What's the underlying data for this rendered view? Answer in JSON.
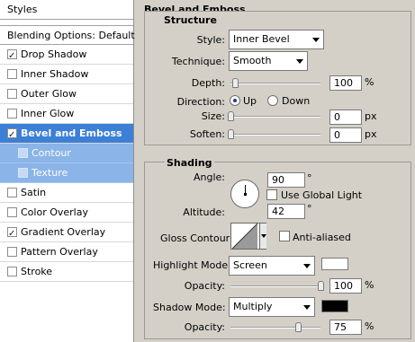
{
  "styles_panel": {
    "title": "Styles",
    "blending_options": "Blending Options: Default",
    "items": [
      {
        "label": "Drop Shadow",
        "checked": true
      },
      {
        "label": "Inner Shadow",
        "checked": false
      },
      {
        "label": "Outer Glow",
        "checked": false
      },
      {
        "label": "Inner Glow",
        "checked": false
      },
      {
        "label": "Bevel and Emboss",
        "checked": true,
        "selected": true
      },
      {
        "label": "Contour",
        "checked": false,
        "sub": true
      },
      {
        "label": "Texture",
        "checked": false,
        "sub": true
      },
      {
        "label": "Satin",
        "checked": false
      },
      {
        "label": "Color Overlay",
        "checked": false
      },
      {
        "label": "Gradient Overlay",
        "checked": true
      },
      {
        "label": "Pattern Overlay",
        "checked": false
      },
      {
        "label": "Stroke",
        "checked": false
      }
    ]
  },
  "bevel": {
    "section_title": "Bevel and Emboss",
    "structure": {
      "title": "Structure",
      "style_label": "Style:",
      "style_value": "Inner Bevel",
      "technique_label": "Technique:",
      "technique_value": "Smooth",
      "depth_label": "Depth:",
      "depth_value": "100",
      "depth_unit": "%",
      "direction_label": "Direction:",
      "direction_up": "Up",
      "direction_down": "Down",
      "direction_selected": "Up",
      "size_label": "Size:",
      "size_value": "0",
      "size_unit": "px",
      "soften_label": "Soften:",
      "soften_value": "0",
      "soften_unit": "px"
    },
    "shading": {
      "title": "Shading",
      "angle_label": "Angle:",
      "angle_value": "90",
      "angle_unit": "°",
      "use_global_light": "Use Global Light",
      "use_global_light_checked": false,
      "altitude_label": "Altitude:",
      "altitude_value": "42",
      "altitude_unit": "°",
      "gloss_contour_label": "Gloss Contour:",
      "anti_aliased": "Anti-aliased",
      "anti_aliased_checked": false,
      "highlight_mode_label": "Highlight Mode:",
      "highlight_mode_value": "Screen",
      "highlight_color": "#ffffff",
      "highlight_opacity_label": "Opacity:",
      "highlight_opacity_value": "100",
      "highlight_opacity_unit": "%",
      "shadow_mode_label": "Shadow Mode:",
      "shadow_mode_value": "Multiply",
      "shadow_color": "#000000",
      "shadow_opacity_label": "Opacity:",
      "shadow_opacity_value": "75",
      "shadow_opacity_unit": "%"
    }
  },
  "colors": {
    "selected_row": "#3c7fd6",
    "sub_row": "#8bb4e8",
    "panel_bg": "#d4d0c8"
  }
}
